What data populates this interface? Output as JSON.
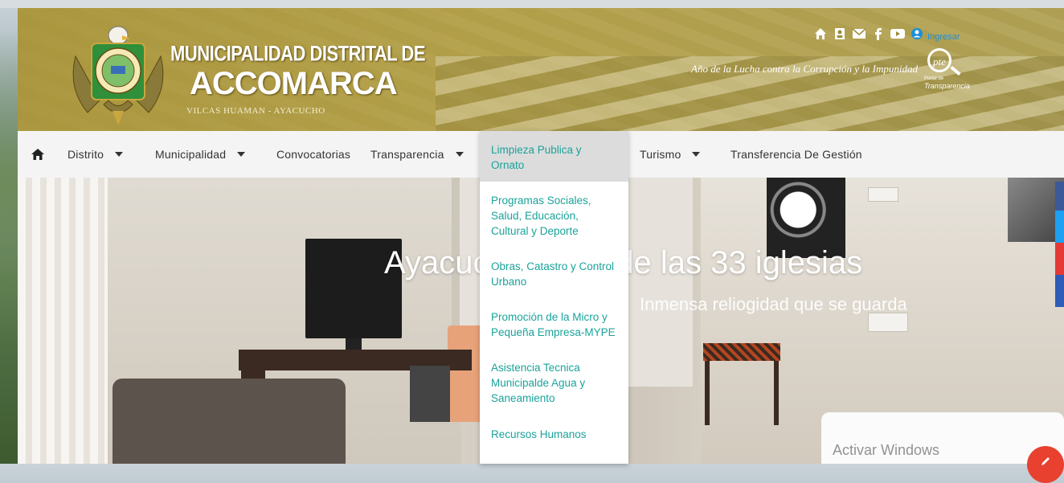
{
  "header": {
    "title_line1": "MUNICIPALIDAD DISTRITAL DE",
    "title_line2": "ACCOMARCA",
    "subtitle": "VILCAS HUAMAN - AYACUCHO",
    "tagline": "Año de la Lucha contra la Corrupción y la Impunidad",
    "ingresar_label": "Ingresar",
    "pte_badge": "pte",
    "pte_caption_small": "Portal de",
    "pte_caption": "Transparencia",
    "top_icons": [
      "home-icon",
      "contacts-icon",
      "mail-icon",
      "facebook-icon",
      "youtube-icon",
      "user-icon"
    ]
  },
  "nav": {
    "items": [
      {
        "label": "Distrito",
        "has_caret": true
      },
      {
        "label": "Municipalidad",
        "has_caret": true
      },
      {
        "label": "Convocatorias",
        "has_caret": false
      },
      {
        "label": "Transparencia",
        "has_caret": true
      },
      {
        "label": "Turismo",
        "has_caret": true
      },
      {
        "label": "Transferencia De Gestión",
        "has_caret": false
      }
    ]
  },
  "dropdown": {
    "items": [
      {
        "label": "Limpieza Publica y Ornato",
        "active": true
      },
      {
        "label": "Programas Sociales, Salud, Educación, Cultural y Deporte"
      },
      {
        "label": "Obras, Catastro y Control Urbano"
      },
      {
        "label": "Promoción de la Micro y Pequeña Empresa-MYPE"
      },
      {
        "label": "Asistencia Tecnica Municipalde Agua y Saneamiento"
      },
      {
        "label": "Recursos Humanos"
      }
    ]
  },
  "hero": {
    "title": "Ayacucho tierra de las 33 iglesias",
    "subtitle": "Inmensa reliogidad que se guarda"
  },
  "system": {
    "activate_windows": "Activar Windows"
  },
  "colors": {
    "dropdown_link": "#1aa39a",
    "dropdown_active_bg": "#dcdcdc",
    "nav_bg": "#f4f4f4",
    "header_overlay": "#aa963c",
    "ingresar": "#1d8fd8",
    "fab": "#e8412f"
  },
  "side_share": [
    {
      "name": "share-blue",
      "color": "#3b5998"
    },
    {
      "name": "share-lightblue",
      "color": "#1da1f2"
    },
    {
      "name": "share-red",
      "color": "#e53935"
    },
    {
      "name": "share-darkblue",
      "color": "#2d5bb8"
    }
  ]
}
